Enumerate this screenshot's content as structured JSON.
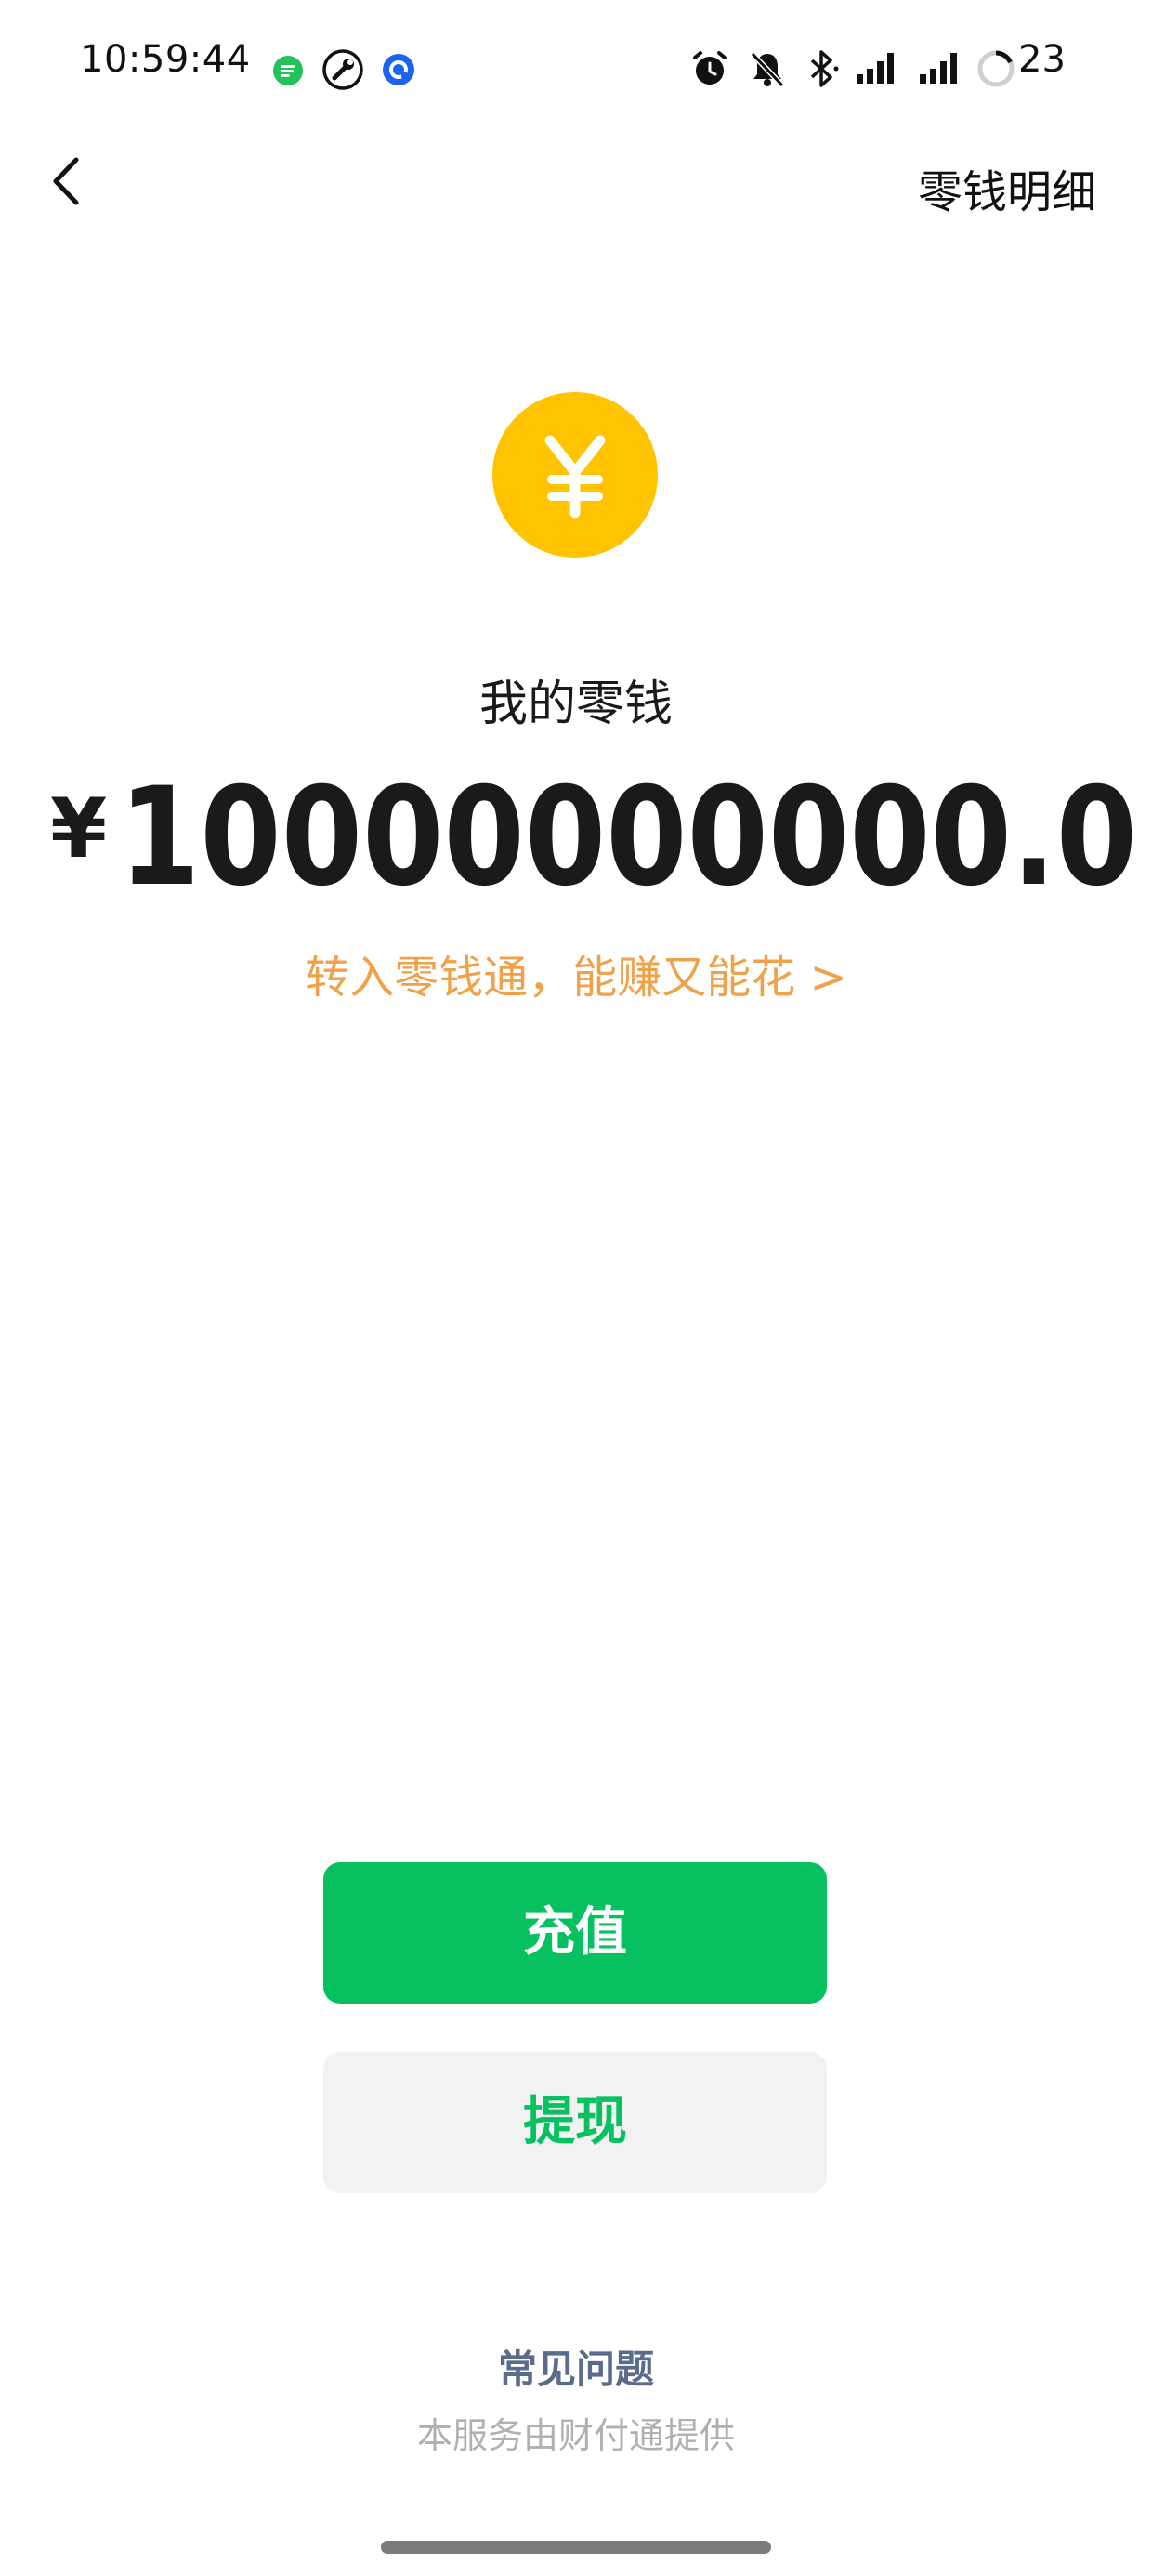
{
  "status_bar": {
    "time": "10:59:44",
    "battery": "23",
    "left_icons": [
      "messages-app-icon",
      "tools-icon",
      "browser-app-icon"
    ],
    "right_icons": [
      "alarm-icon",
      "notifications-muted-icon",
      "bluetooth-icon",
      "signal-icon",
      "signal-icon",
      "battery-icon"
    ]
  },
  "header": {
    "back_icon": "chevron-left-icon",
    "details_link": "零钱明细"
  },
  "balance": {
    "coin_icon": "yuan-coin-icon",
    "label": "我的零钱",
    "currency_symbol": "¥",
    "amount": "10000000000.0"
  },
  "promo": {
    "text": "转入零钱通，能赚又能花 >"
  },
  "actions": {
    "recharge_label": "充值",
    "withdraw_label": "提现"
  },
  "footer": {
    "faq_label": "常见问题",
    "provider_text": "本服务由财付通提供"
  },
  "colors": {
    "primary_green": "#07C160",
    "coin_yellow": "#FFC300",
    "promo_orange": "#F0A24A",
    "faq_blue_gray": "#5B6B8C",
    "secondary_button_bg": "#F2F2F2"
  }
}
